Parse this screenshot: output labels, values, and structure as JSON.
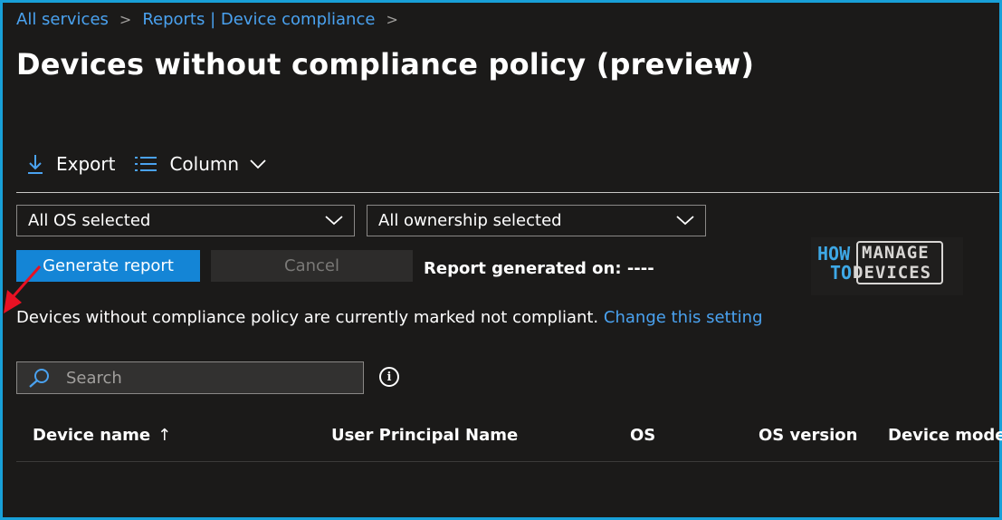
{
  "breadcrumb": {
    "items": [
      "All services",
      "Reports | Device compliance"
    ],
    "separator": ">"
  },
  "page": {
    "title": "Devices without compliance policy (preview)",
    "more": "..."
  },
  "toolbar": {
    "export_label": "Export",
    "column_label": "Column"
  },
  "filters": {
    "os_value": "All OS selected",
    "ownership_value": "All ownership selected"
  },
  "actions": {
    "generate_label": "Generate report",
    "cancel_label": "Cancel",
    "report_generated_label": "Report generated on: ----"
  },
  "logo": {
    "line1_left": "HOW",
    "line2_left": "TO",
    "line1_right": "MANAGE",
    "line2_right": "DEVICES"
  },
  "notice": {
    "text": "Devices without compliance policy are currently marked not compliant.",
    "link": "Change this setting"
  },
  "search": {
    "placeholder": "Search",
    "info": "i"
  },
  "table": {
    "columns": [
      "Device name",
      "User Principal Name",
      "OS",
      "OS version",
      "Device model"
    ],
    "sort_indicator": "↑"
  },
  "colors": {
    "background": "#1b1a19",
    "accent": "#1485d6",
    "link": "#4aa2f0",
    "frame": "#18a0d8"
  }
}
